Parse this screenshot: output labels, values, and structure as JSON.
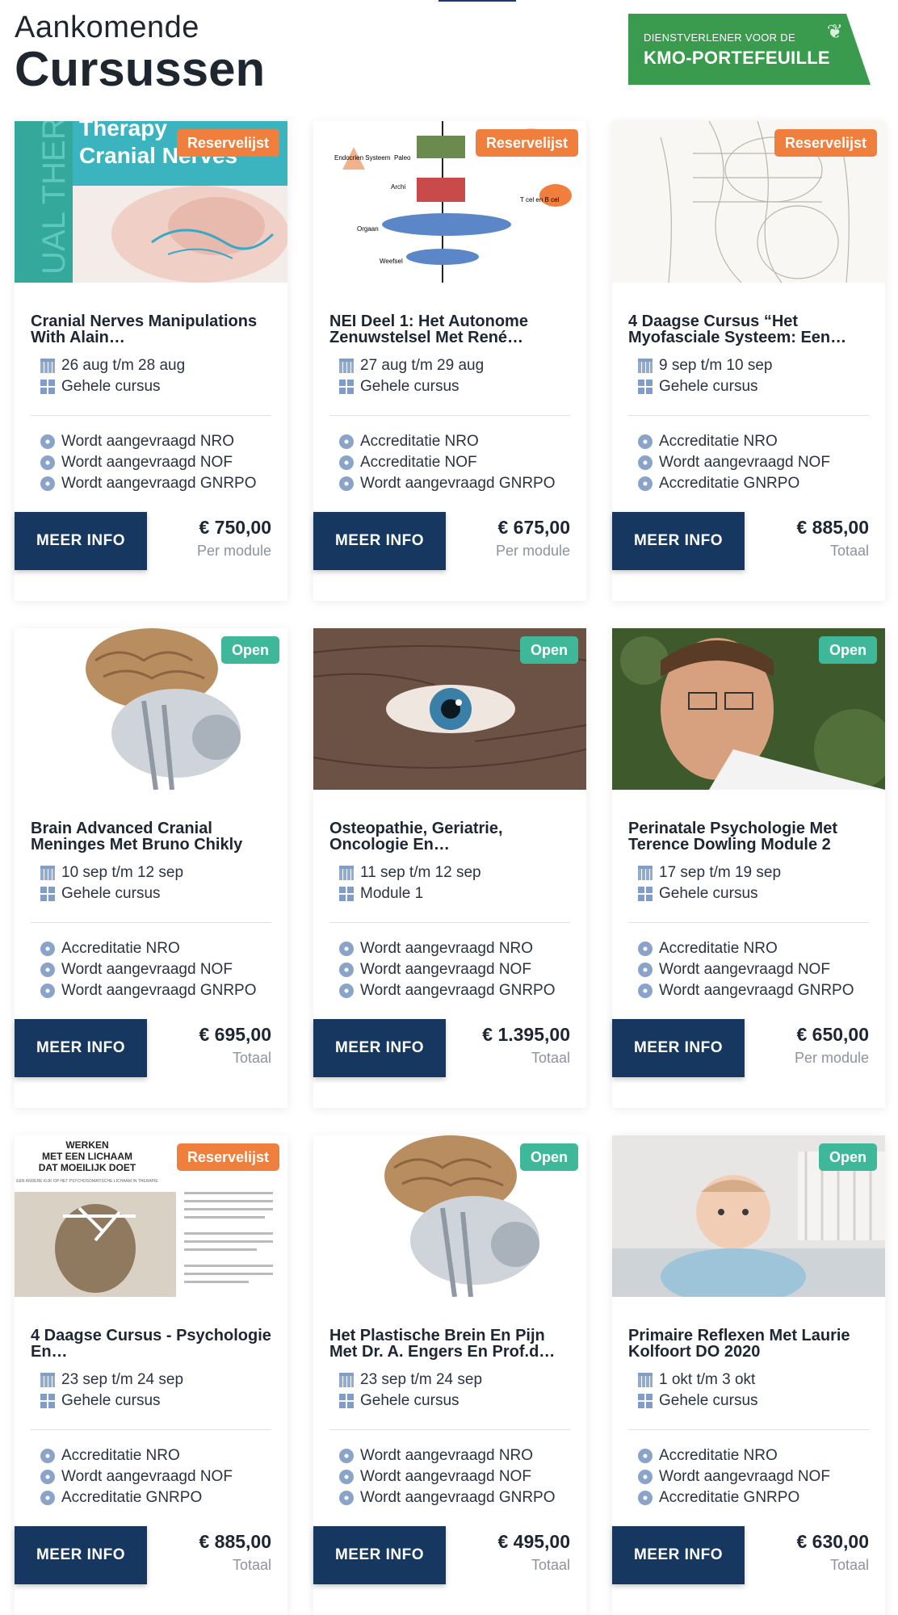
{
  "header": {
    "subtitle": "Aankomende",
    "title": "Cursussen"
  },
  "kmo": {
    "top": "DIENSTVERLENER VOOR DE",
    "main": "KMO-PORTEFEUILLE"
  },
  "colors": {
    "primary": "#163860",
    "reserve": "#f07e3d",
    "open": "#3fb89a",
    "kmo": "#3a9a4d"
  },
  "courses": [
    {
      "badge": "Reservelijst",
      "title": "Cranial Nerves Manipulations With Alain…",
      "dates": "26 aug t/m 28 aug",
      "module": "Gehele cursus",
      "acc": [
        "Wordt aangevraagd NRO",
        "Wordt aangevraagd NOF",
        "Wordt aangevraagd GNRPO"
      ],
      "button": "MEER INFO",
      "price": "€ 750,00",
      "unit": "Per module"
    },
    {
      "badge": "Reservelijst",
      "title": "NEI Deel 1: Het Autonome Zenuwstelsel Met René…",
      "dates": "27 aug t/m 29 aug",
      "module": "Gehele cursus",
      "acc": [
        "Accreditatie NRO",
        "Accreditatie NOF",
        "Wordt aangevraagd GNRPO"
      ],
      "button": "MEER INFO",
      "price": "€ 675,00",
      "unit": "Per module"
    },
    {
      "badge": "Reservelijst",
      "title": "4 Daagse Cursus “Het Myofasciale Systeem: Een…",
      "dates": "9 sep t/m 10 sep",
      "module": "Gehele cursus",
      "acc": [
        "Accreditatie NRO",
        "Wordt aangevraagd NOF",
        "Accreditatie GNRPO"
      ],
      "button": "MEER INFO",
      "price": "€ 885,00",
      "unit": "Totaal"
    },
    {
      "badge": "Open",
      "title": "Brain Advanced Cranial Meninges Met Bruno Chikly",
      "dates": "10 sep t/m 12 sep",
      "module": "Gehele cursus",
      "acc": [
        "Accreditatie NRO",
        "Wordt aangevraagd NOF",
        "Wordt aangevraagd GNRPO"
      ],
      "button": "MEER INFO",
      "price": "€ 695,00",
      "unit": "Totaal"
    },
    {
      "badge": "Open",
      "title": "Osteopathie, Geriatrie, Oncologie En…",
      "dates": "11 sep t/m 12 sep",
      "module": "Module 1",
      "acc": [
        "Wordt aangevraagd NRO",
        "Wordt aangevraagd NOF",
        "Wordt aangevraagd GNRPO"
      ],
      "button": "MEER INFO",
      "price": "€ 1.395,00",
      "unit": "Totaal"
    },
    {
      "badge": "Open",
      "title": "Perinatale Psychologie Met Terence Dowling Module 2",
      "dates": "17 sep t/m 19 sep",
      "module": "Gehele cursus",
      "acc": [
        "Accreditatie NRO",
        "Wordt aangevraagd NOF",
        "Wordt aangevraagd GNRPO"
      ],
      "button": "MEER INFO",
      "price": "€ 650,00",
      "unit": "Per module"
    },
    {
      "badge": "Reservelijst",
      "title": "4 Daagse Cursus - Psychologie En…",
      "dates": "23 sep t/m 24 sep",
      "module": "Gehele cursus",
      "acc": [
        "Accreditatie NRO",
        "Wordt aangevraagd NOF",
        "Accreditatie GNRPO"
      ],
      "button": "MEER INFO",
      "price": "€ 885,00",
      "unit": "Totaal"
    },
    {
      "badge": "Open",
      "title": "Het Plastische Brein En Pijn Met Dr. A. Engers En Prof.d…",
      "dates": "23 sep t/m 24 sep",
      "module": "Gehele cursus",
      "acc": [
        "Wordt aangevraagd NRO",
        "Wordt aangevraagd NOF",
        "Wordt aangevraagd GNRPO"
      ],
      "button": "MEER INFO",
      "price": "€ 495,00",
      "unit": "Totaal"
    },
    {
      "badge": "Open",
      "title": "Primaire Reflexen Met Laurie Kolfoort DO 2020",
      "dates": "1 okt t/m 3 okt",
      "module": "Gehele cursus",
      "acc": [
        "Accreditatie NRO",
        "Wordt aangevraagd NOF",
        "Accreditatie GNRPO"
      ],
      "button": "MEER INFO",
      "price": "€ 630,00",
      "unit": "Totaal"
    }
  ],
  "thumbs": {
    "c0": {
      "t1": "Therapy",
      "t2": "Cranial Nerves",
      "side": "UAL THERA"
    },
    "c1": {
      "a": "Endocrien Systeem",
      "b": "Paleo",
      "c": "Archi",
      "d": "T cel en B cel",
      "e": "Orgaan",
      "f": "Weefsel"
    },
    "c6": {
      "a": "WERKEN",
      "b": "MET EEN LICHAAM",
      "c": "DAT MOEILIJK DOET",
      "d": "EEN ANDERE KIJK OP HET PSYCHOSOMATISCHE LICHAAM IN THERAPIE"
    }
  }
}
